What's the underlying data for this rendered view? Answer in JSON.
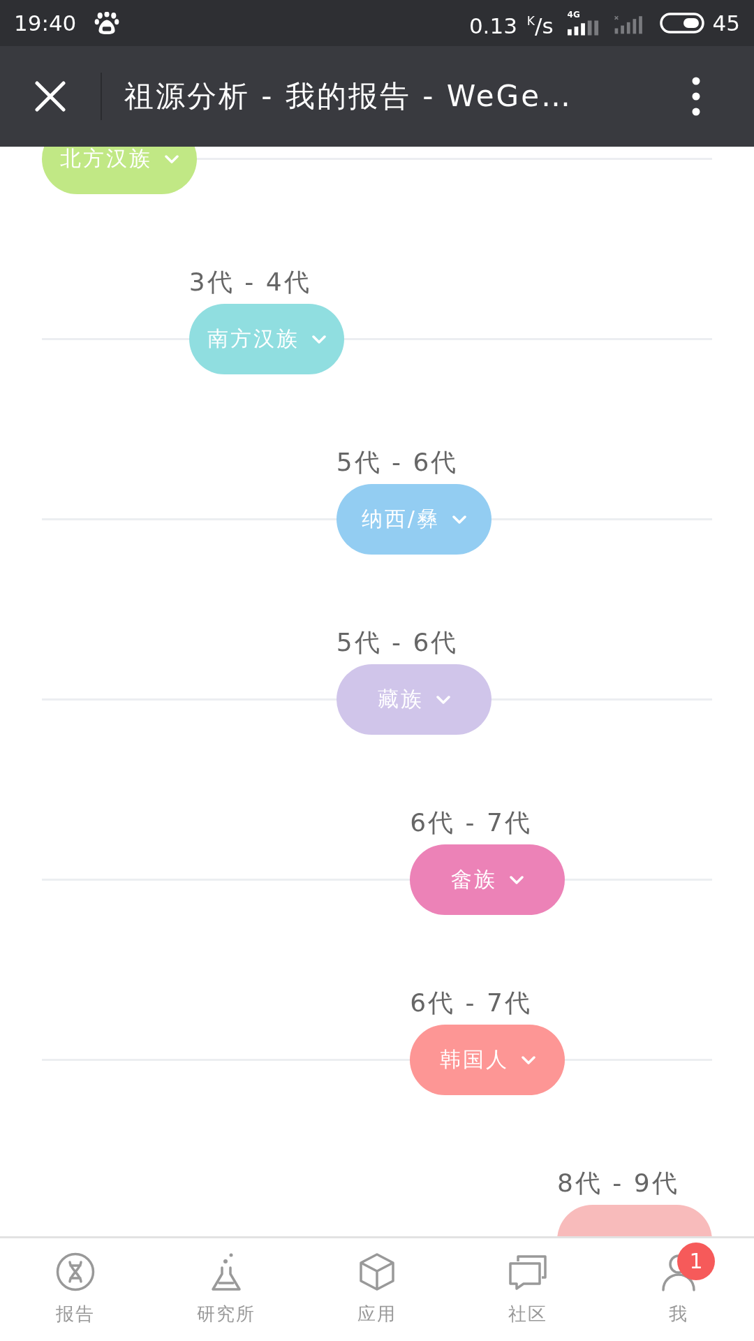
{
  "status_bar": {
    "time": "19:40",
    "net_speed": "0.13 $^{K}$/s",
    "network_type": "4G",
    "battery": "45"
  },
  "header": {
    "title": "祖源分析 - 我的报告 - WeGe…"
  },
  "timeline": [
    {
      "pill": "北方汉族",
      "color": "#c1e885"
    },
    {
      "range": "3代 - 4代",
      "pill": "南方汉族",
      "color": "#90dee0"
    },
    {
      "range": "5代 - 6代",
      "pill": "纳西/彝",
      "color": "#93cdf2"
    },
    {
      "range": "5代 - 6代",
      "pill": "藏族",
      "color": "#d0c5ea"
    },
    {
      "range": "6代 - 7代",
      "pill": "畲族",
      "color": "#ec82b7"
    },
    {
      "range": "6代 - 7代",
      "pill": "韩国人",
      "color": "#fd9695"
    },
    {
      "range": "8代 - 9代",
      "color": "#f8bbbb"
    }
  ],
  "tab_bar": [
    {
      "label": "报告",
      "selected": false
    },
    {
      "label": "研究所",
      "selected": false
    },
    {
      "label": "应用",
      "selected": false
    },
    {
      "label": "社区",
      "selected": false
    },
    {
      "label": "我",
      "selected": false,
      "badge": "1"
    }
  ]
}
